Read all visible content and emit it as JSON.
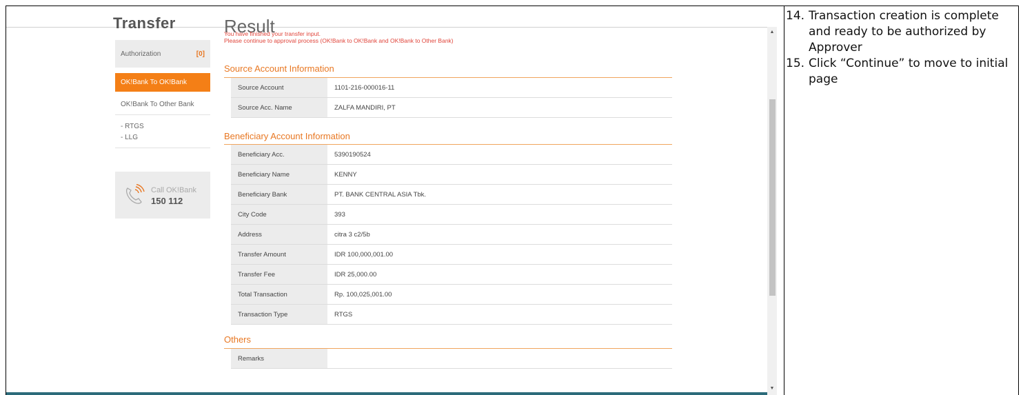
{
  "sidebar": {
    "title": "Transfer",
    "authorization_label": "Authorization",
    "authorization_count": "[0]",
    "active_item": "OK!Bank To OK!Bank",
    "item_other_bank": "OK!Bank To Other Bank",
    "sub_items": [
      "- RTGS",
      "- LLG"
    ],
    "call_label": "Call OK!Bank",
    "call_number": "150 112"
  },
  "result": {
    "title": "Result",
    "message_line1": "You have finished your transfer input.",
    "message_line2": "Please continue to approval process (OK!Bank to OK!Bank and OK!Bank to Other Bank)"
  },
  "sections": {
    "source": {
      "title": "Source Account Information",
      "rows": [
        {
          "label": "Source Account",
          "value": "1101-216-000016-11"
        },
        {
          "label": "Source Acc. Name",
          "value": "ZALFA MANDIRI, PT"
        }
      ]
    },
    "beneficiary": {
      "title": "Beneficiary Account Information",
      "rows": [
        {
          "label": "Beneficiary Acc.",
          "value": "5390190524"
        },
        {
          "label": "Beneficiary Name",
          "value": "KENNY"
        },
        {
          "label": "Beneficiary Bank",
          "value": "PT. BANK CENTRAL ASIA Tbk."
        },
        {
          "label": "City Code",
          "value": "393"
        },
        {
          "label": "Address",
          "value": "citra 3 c2/5b"
        },
        {
          "label": "Transfer Amount",
          "value": "IDR 100,000,001.00"
        },
        {
          "label": "Transfer Fee",
          "value": "IDR 25,000.00"
        },
        {
          "label": "Total Transaction",
          "value": "Rp. 100,025,001.00"
        },
        {
          "label": "Transaction Type",
          "value": "RTGS"
        }
      ]
    },
    "others": {
      "title": "Others",
      "rows": [
        {
          "label": "Remarks",
          "value": ""
        }
      ]
    }
  },
  "instructions": [
    {
      "number": "14.",
      "text": "Transaction creation is complete and ready to be authorized by Approver"
    },
    {
      "number": "15.",
      "text": "Click “Continue” to move to initial page"
    }
  ],
  "colors": {
    "accent": "#f47f16",
    "error_text": "#e0443a",
    "panel_bg": "#ececec"
  },
  "icons": [
    "phone-icon",
    "scroll-up-arrow-icon",
    "scroll-down-arrow-icon"
  ]
}
